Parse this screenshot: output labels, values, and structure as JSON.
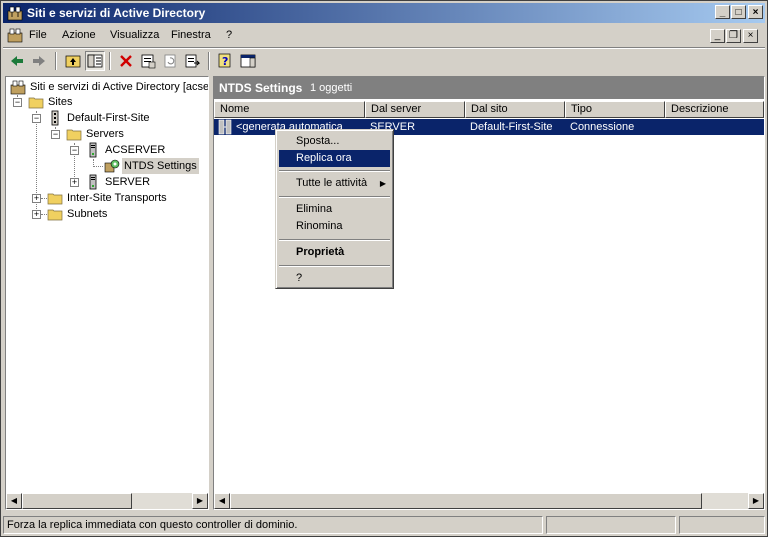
{
  "window": {
    "title": "Siti e servizi di Active Directory",
    "controls": {
      "minimize": "_",
      "maximize": "□",
      "close": "×"
    }
  },
  "menubar": {
    "items": [
      {
        "label": "File"
      },
      {
        "label": "Azione"
      },
      {
        "label": "Visualizza"
      },
      {
        "label": "Finestra"
      },
      {
        "label": "?"
      }
    ]
  },
  "tree": {
    "root": "Siti e servizi di Active Directory [acser",
    "sites": "Sites",
    "default_site": "Default-First-Site",
    "servers": "Servers",
    "acserver": "ACSERVER",
    "ntds": "NTDS Settings",
    "server": "SERVER",
    "inter_site": "Inter-Site Transports",
    "subnets": "Subnets"
  },
  "right_pane": {
    "title": "NTDS Settings",
    "count": "1 oggetti",
    "columns": [
      "Nome",
      "Dal server",
      "Dal sito",
      "Tipo",
      "Descrizione"
    ],
    "rows": [
      {
        "name": "<generata automatica",
        "from_server": "SERVER",
        "from_site": "Default-First-Site",
        "type": "Connessione",
        "description": ""
      }
    ]
  },
  "context_menu": {
    "items": [
      "Sposta...",
      "Replica ora",
      "Tutte le attività",
      "Elimina",
      "Rinomina",
      "Proprietà",
      "?"
    ],
    "highlighted": "Replica ora"
  },
  "status": {
    "text": "Forza la replica immediata con questo controller di dominio."
  },
  "colors": {
    "titlebar": "#0a246a",
    "selection": "#0a246a",
    "face": "#d4d0c8"
  }
}
